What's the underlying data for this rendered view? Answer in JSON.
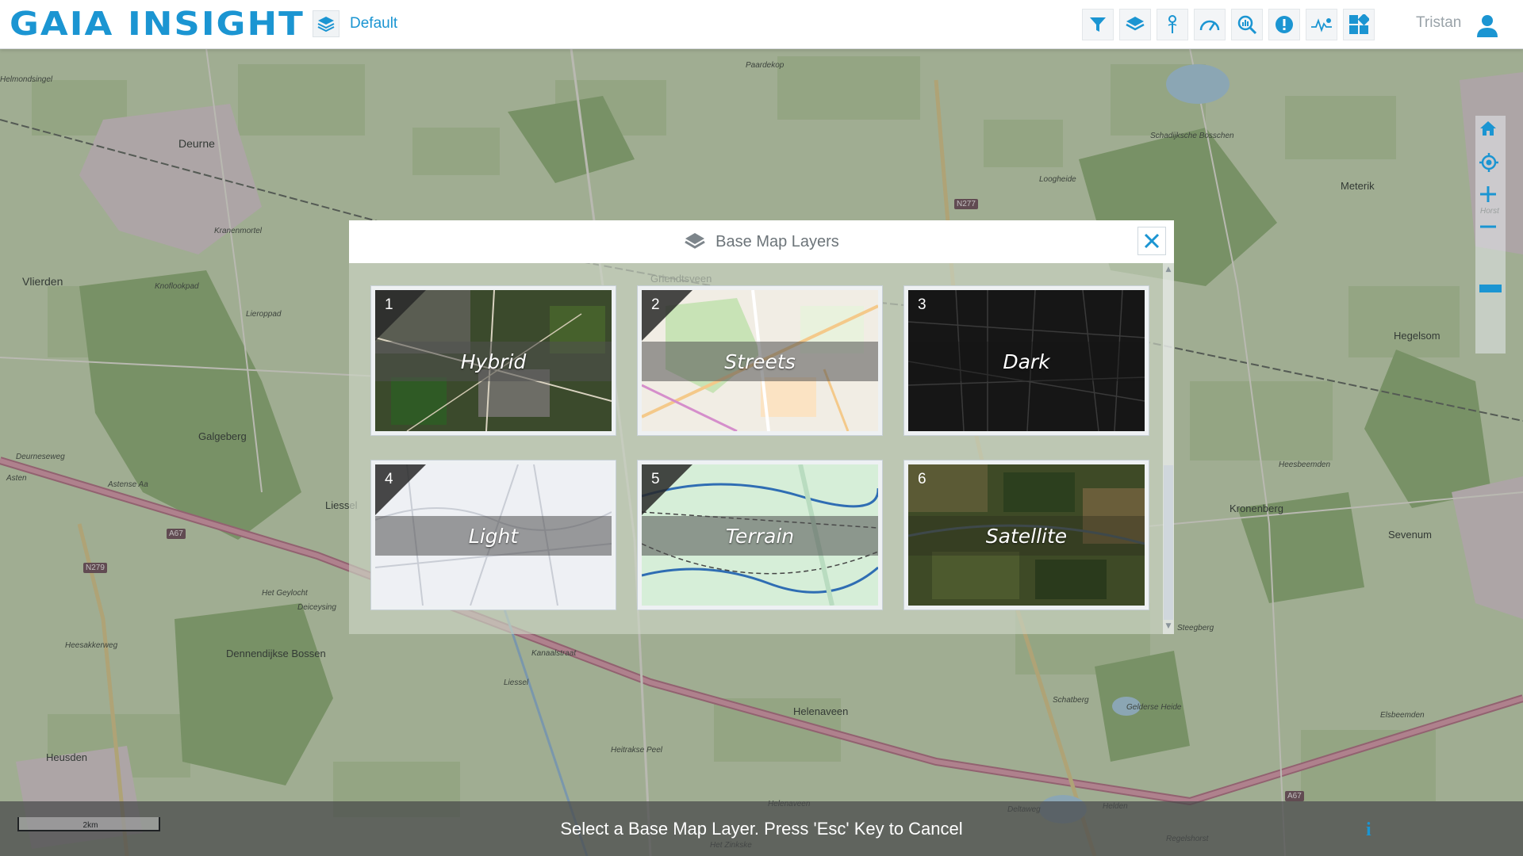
{
  "header": {
    "logo_text": "GAIA INSIGHT",
    "profile_label": "Default",
    "username": "Tristan",
    "accent_color": "#1b95d2",
    "toolbar_icons": [
      "filter-icon",
      "layers-icon",
      "pin-icon",
      "gauge-icon",
      "analytics-icon",
      "alert-icon",
      "signal-icon",
      "dashboard-icon"
    ]
  },
  "map": {
    "places": [
      "Deurne",
      "Vlierden",
      "Galgeberg",
      "Liessel",
      "Heusden",
      "Dennendijkse Bossen",
      "Helenaveen",
      "Griendtsveen",
      "Schadijksche Bosschen",
      "Meterik",
      "Hegelsom",
      "Kronenberg",
      "Sevenum",
      "Heesbeemden",
      "Elsbeemden",
      "Schatberg",
      "Gelderse Heide",
      "Steegberg",
      "Het Zinkske",
      "Paardekop",
      "Loogheide",
      "Kranenmortel",
      "Astense Aa",
      "Het Geylocht",
      "Heitrakse Peel",
      "Horst"
    ],
    "road_shields": [
      "A67",
      "N279",
      "N277",
      "A67"
    ],
    "road_labels": [
      "Helmondsingel",
      "Knoflookpad",
      "Deurneseweg",
      "Asten",
      "Kanaalstraat",
      "Liessel",
      "Helenaveen",
      "Helden",
      "Deltaweg",
      "Deiceysing",
      "Heesakkerweg",
      "Regelshorst",
      "Lieroppad"
    ],
    "scale_label": "2km",
    "controls": [
      "home-icon",
      "locate-icon",
      "zoom-in-icon",
      "zoom-out-icon"
    ]
  },
  "modal": {
    "title": "Base Map Layers",
    "close_icon": "close-icon",
    "title_icon": "layers-icon",
    "tiles": [
      {
        "number": "1",
        "label": "Hybrid"
      },
      {
        "number": "2",
        "label": "Streets"
      },
      {
        "number": "3",
        "label": "Dark"
      },
      {
        "number": "4",
        "label": "Light"
      },
      {
        "number": "5",
        "label": "Terrain"
      },
      {
        "number": "6",
        "label": "Satellite"
      }
    ]
  },
  "bottom_bar": {
    "message": "Select a Base Map Layer.  Press 'Esc' Key to Cancel",
    "info_label": "i"
  }
}
